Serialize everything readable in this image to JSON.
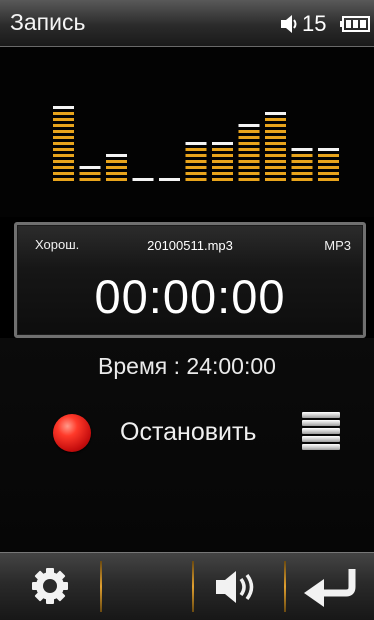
{
  "status_bar": {
    "title": "Запись",
    "volume_level": "15",
    "volume_icon": "speaker-icon",
    "battery_icon": "battery-icon"
  },
  "equalizer": {
    "segment_color_top": "#f4f4f4",
    "segment_color_bottom": "#e8a41c",
    "levels": [
      13,
      3,
      5,
      1,
      1,
      7,
      7,
      10,
      12,
      6,
      6
    ]
  },
  "recording_panel": {
    "quality": "Хорош.",
    "filename": "20100511.mp3",
    "format": "MP3",
    "timer": "00:00:00"
  },
  "time_remaining": "Время : 24:00:00",
  "controls": {
    "record_icon": "record-icon",
    "stop_label": "Остановить",
    "list_icon": "list-icon"
  },
  "toolbar": {
    "settings_icon": "gear-icon",
    "empty_slot": "",
    "volume_icon": "speaker-icon",
    "back_icon": "back-arrow-icon",
    "separator_color": "#e0a030"
  }
}
